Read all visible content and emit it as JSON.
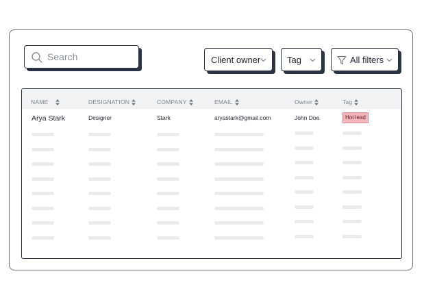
{
  "search": {
    "placeholder": "Search"
  },
  "filters": {
    "client_owner_label": "Client owner",
    "tag_label": "Tag",
    "all_filters_label": "All filters"
  },
  "table": {
    "columns": [
      "NAME",
      "DESIGNATION",
      "COMPANY",
      "EMAIL",
      "Owner",
      "Tag"
    ],
    "rows": [
      {
        "name": "Arya Stark",
        "designation": "Designer",
        "company": "Stark",
        "email": "aryastark@gmail.com",
        "owner": "John Doe",
        "tag": "Hot lead"
      }
    ],
    "placeholder_rows": 8
  },
  "colors": {
    "accent_shadow": "#2b3445",
    "badge_bg": "#f1b4b8"
  },
  "icons": {
    "search": "search-icon",
    "chevron": "chevron-down-icon",
    "filter": "filter-icon",
    "sort": "sort-icon"
  }
}
